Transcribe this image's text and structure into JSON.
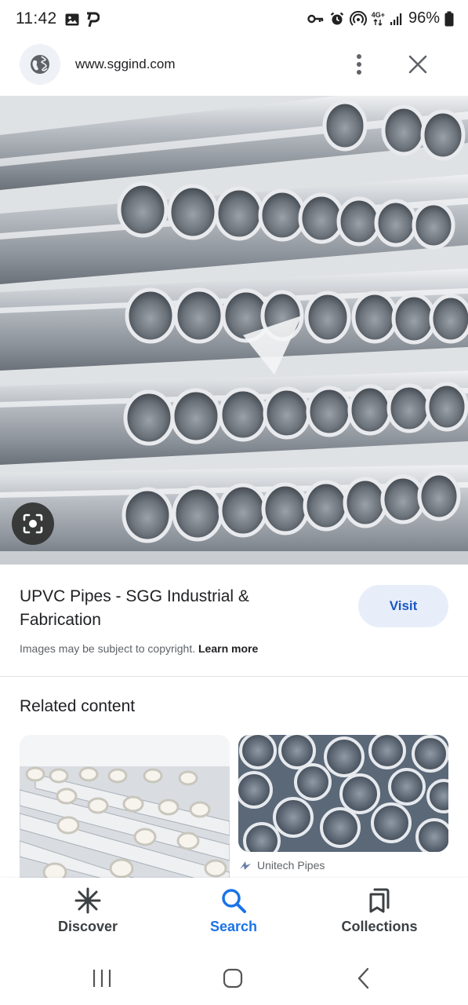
{
  "status_bar": {
    "time": "11:42",
    "network": "4G+",
    "battery": "96%",
    "left_icons": [
      "gallery-icon",
      "p-icon"
    ],
    "right_icons": [
      "key-icon",
      "alarm-icon",
      "hotspot-icon",
      "signal-icon",
      "battery-icon"
    ]
  },
  "url_bar": {
    "url": "www.sggind.com",
    "icons": [
      "globe-icon",
      "more-vert-icon",
      "close-icon"
    ]
  },
  "image": {
    "alt": "UPVC pipes stacked",
    "lens_icon": "lens-icon"
  },
  "details": {
    "title": "UPVC Pipes - SGG Industrial & Fabrication",
    "visit_label": "Visit",
    "copyright_text": "Images may be subject to copyright.",
    "learn_more": "Learn more"
  },
  "related": {
    "heading": "Related content",
    "cards": [
      {
        "source": ""
      },
      {
        "source": "Unitech Pipes"
      }
    ]
  },
  "bottom_nav": {
    "items": [
      {
        "label": "Discover",
        "icon": "asterisk-icon",
        "active": false
      },
      {
        "label": "Search",
        "icon": "search-icon",
        "active": true
      },
      {
        "label": "Collections",
        "icon": "bookmarks-icon",
        "active": false
      }
    ]
  },
  "colors": {
    "accent": "#1a73e8",
    "visit_bg": "#e8eef9",
    "visit_text": "#1a57c5"
  }
}
